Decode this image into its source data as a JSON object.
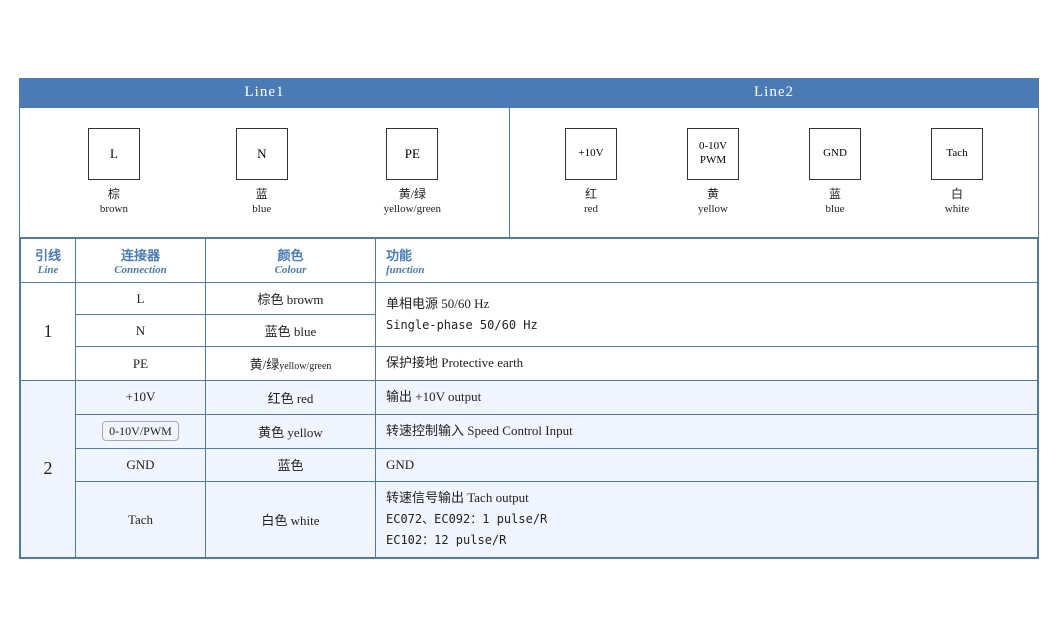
{
  "header": {
    "line1_label": "Line1",
    "line2_label": "Line2"
  },
  "line1_connectors": [
    {
      "box_label": "L",
      "cn": "棕",
      "en": "brown"
    },
    {
      "box_label": "N",
      "cn": "蓝",
      "en": "blue"
    },
    {
      "box_label": "PE",
      "cn": "黄/绿",
      "en": "yellow/green"
    }
  ],
  "line2_connectors": [
    {
      "box_label": "+10V",
      "cn": "红",
      "en": "red"
    },
    {
      "box_label": "0-10V\nPWM",
      "cn": "黄",
      "en": "yellow"
    },
    {
      "box_label": "GND",
      "cn": "蓝",
      "en": "blue"
    },
    {
      "box_label": "Tach",
      "cn": "白",
      "en": "white"
    }
  ],
  "table": {
    "headers": {
      "line_cn": "引线",
      "line_en": "Line",
      "conn_cn": "连接器",
      "conn_en": "Connection",
      "color_cn": "颜色",
      "color_en": "Colour",
      "func_cn": "功能",
      "func_en": "function"
    },
    "rows": [
      {
        "group": "1",
        "rowspan": 3,
        "items": [
          {
            "conn": "L",
            "color": "棕色 browm",
            "func": "单相电源 50/60 Hz\nSingle-phase 50/60 Hz"
          },
          {
            "conn": "N",
            "color": "蓝色 blue",
            "func": ""
          },
          {
            "conn": "PE",
            "color": "黄/绿yellow/green",
            "func": "保护接地 Protective earth"
          }
        ]
      },
      {
        "group": "2",
        "rowspan": 4,
        "items": [
          {
            "conn": "+10V",
            "color": "红色 red",
            "func": "输出 +10V output"
          },
          {
            "conn": "0-10V/PWM",
            "color": "黄色 yellow",
            "func": "转速控制输入 Speed Control Input"
          },
          {
            "conn": "GND",
            "color": "蓝色",
            "func": "GND"
          },
          {
            "conn": "Tach",
            "color": "白色 white",
            "func": "转速信号输出 Tach output\nEC072、EC092：1 pulse/R\nEC102：12 pulse/R"
          }
        ]
      }
    ]
  }
}
